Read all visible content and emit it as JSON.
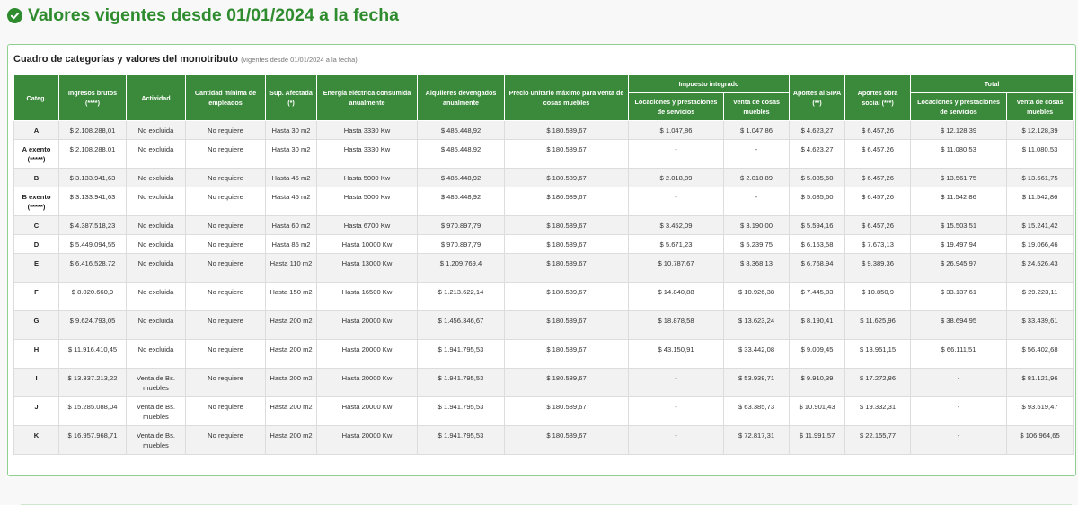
{
  "page": {
    "title": "Valores vigentes desde 01/01/2024 a la fecha",
    "accent_color": "#2e8b2e",
    "title_icon": "check-circle-icon"
  },
  "panel": {
    "title": "Cuadro de categorías y valores del monotributo",
    "subtitle": "(vigentes desde 01/01/2024 a la fecha)"
  },
  "table": {
    "group_headers": {
      "impuesto_integrado": "Impuesto integrado",
      "total": "Total"
    },
    "columns": [
      "Categ.",
      "Ingresos brutos (****)",
      "Actividad",
      "Cantidad mínima de empleados",
      "Sup. Afectada (*)",
      "Energía eléctrica consumida anualmente",
      "Alquileres devengados anualmente",
      "Precio unitario máximo para venta de cosas muebles",
      "Locaciones y prestaciones de servicios",
      "Venta de cosas muebles",
      "Aportes al SIPA (**)",
      "Aportes obra social (***)",
      "Locaciones y prestaciones de servicios",
      "Venta de cosas muebles"
    ],
    "rows": [
      [
        "A",
        "$ 2.108.288,01",
        "No excluida",
        "No requiere",
        "Hasta 30 m2",
        "Hasta 3330 Kw",
        "$ 485.448,92",
        "$ 180.589,67",
        "$ 1.047,86",
        "$ 1.047,86",
        "$ 4.623,27",
        "$ 6.457,26",
        "$ 12.128,39",
        "$ 12.128,39"
      ],
      [
        "A exento (*****)",
        "$ 2.108.288,01",
        "No excluida",
        "No requiere",
        "Hasta 30 m2",
        "Hasta 3330 Kw",
        "$ 485.448,92",
        "$ 180.589,67",
        "-",
        "-",
        "$ 4.623,27",
        "$ 6.457,26",
        "$ 11.080,53",
        "$ 11.080,53"
      ],
      [
        "B",
        "$ 3.133.941,63",
        "No excluida",
        "No requiere",
        "Hasta 45 m2",
        "Hasta 5000 Kw",
        "$ 485.448,92",
        "$ 180.589,67",
        "$ 2.018,89",
        "$ 2.018,89",
        "$ 5.085,60",
        "$ 6.457,26",
        "$ 13.561,75",
        "$ 13.561,75"
      ],
      [
        "B exento (*****)",
        "$ 3.133.941,63",
        "No excluida",
        "No requiere",
        "Hasta 45 m2",
        "Hasta 5000 Kw",
        "$ 485.448,92",
        "$ 180.589,67",
        "-",
        "-",
        "$ 5.085,60",
        "$ 6.457,26",
        "$ 11.542,86",
        "$ 11.542,86"
      ],
      [
        "C",
        "$ 4.387.518,23",
        "No excluida",
        "No requiere",
        "Hasta 60 m2",
        "Hasta 6700 Kw",
        "$ 970.897,79",
        "$ 180.589,67",
        "$ 3.452,09",
        "$ 3.190,00",
        "$ 5.594,16",
        "$ 6.457,26",
        "$ 15.503,51",
        "$ 15.241,42"
      ],
      [
        "D",
        "$ 5.449.094,55",
        "No excluida",
        "No requiere",
        "Hasta 85 m2",
        "Hasta 10000 Kw",
        "$ 970.897,79",
        "$ 180.589,67",
        "$ 5.671,23",
        "$ 5.239,75",
        "$ 6.153,58",
        "$ 7.673,13",
        "$ 19.497,94",
        "$ 19.066,46"
      ],
      [
        "E",
        "$ 6.416.528,72",
        "No excluida",
        "No requiere",
        "Hasta 110 m2",
        "Hasta 13000 Kw",
        "$ 1.209.769,4",
        "$ 180.589,67",
        "$ 10.787,67",
        "$ 8.368,13",
        "$ 6.768,94",
        "$ 9.389,36",
        "$ 26.945,97",
        "$ 24.526,43"
      ],
      [
        "F",
        "$ 8.020.660,9",
        "No excluida",
        "No requiere",
        "Hasta 150 m2",
        "Hasta 16500 Kw",
        "$ 1.213.622,14",
        "$ 180.589,67",
        "$ 14.840,88",
        "$ 10.926,38",
        "$ 7.445,83",
        "$ 10.850,9",
        "$ 33.137,61",
        "$ 29.223,11"
      ],
      [
        "G",
        "$ 9.624.793,05",
        "No excluida",
        "No requiere",
        "Hasta 200 m2",
        "Hasta 20000 Kw",
        "$ 1.456.346,67",
        "$ 180.589,67",
        "$ 18.878,58",
        "$ 13.623,24",
        "$ 8.190,41",
        "$ 11.625,96",
        "$ 38.694,95",
        "$ 33.439,61"
      ],
      [
        "H",
        "$ 11.916.410,45",
        "No excluida",
        "No requiere",
        "Hasta 200 m2",
        "Hasta 20000 Kw",
        "$ 1.941.795,53",
        "$ 180.589,67",
        "$ 43.150,91",
        "$ 33.442,08",
        "$ 9.009,45",
        "$ 13.951,15",
        "$ 66.111,51",
        "$ 56.402,68"
      ],
      [
        "I",
        "$ 13.337.213,22",
        "Venta de Bs. muebles",
        "No requiere",
        "Hasta 200 m2",
        "Hasta 20000 Kw",
        "$ 1.941.795,53",
        "$ 180.589,67",
        "-",
        "$ 53.938,71",
        "$ 9.910,39",
        "$ 17.272,86",
        "-",
        "$ 81.121,96"
      ],
      [
        "J",
        "$ 15.285.088,04",
        "Venta de Bs. muebles",
        "No requiere",
        "Hasta 200 m2",
        "Hasta 20000 Kw",
        "$ 1.941.795,53",
        "$ 180.589,67",
        "-",
        "$ 63.385,73",
        "$ 10.901,43",
        "$ 19.332,31",
        "-",
        "$ 93.619,47"
      ],
      [
        "K",
        "$ 16.957.968,71",
        "Venta de Bs. muebles",
        "No requiere",
        "Hasta 200 m2",
        "Hasta 20000 Kw",
        "$ 1.941.795,53",
        "$ 180.589,67",
        "-",
        "$ 72.817,31",
        "$ 11.991,57",
        "$ 22.155,77",
        "-",
        "$ 106.964,65"
      ]
    ]
  }
}
